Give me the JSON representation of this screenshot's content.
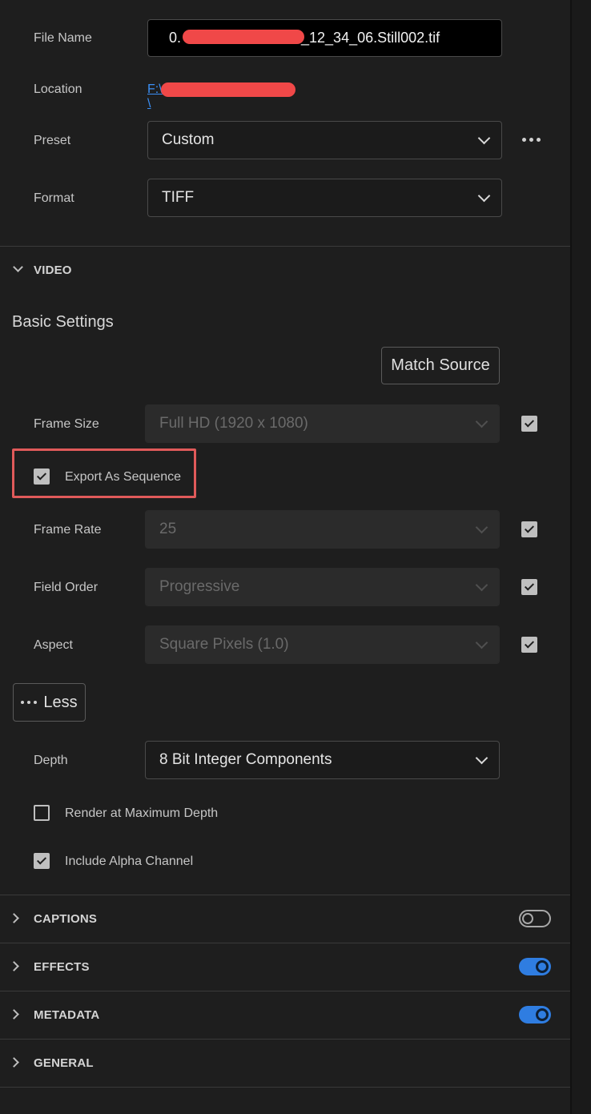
{
  "file": {
    "filename_label": "File Name",
    "filename_prefix": "0.",
    "filename_suffix": "_12_34_06.Still002.tif",
    "location_label": "Location",
    "location_prefix": "F:\\",
    "location_suffix": "\\",
    "preset_label": "Preset",
    "preset_value": "Custom",
    "format_label": "Format",
    "format_value": "TIFF"
  },
  "video": {
    "section_title": "VIDEO",
    "basic_settings": "Basic Settings",
    "match_source": "Match Source",
    "frame_size_label": "Frame Size",
    "frame_size_value": "Full HD (1920 x 1080)",
    "export_as_sequence": "Export As Sequence",
    "frame_rate_label": "Frame Rate",
    "frame_rate_value": "25",
    "field_order_label": "Field Order",
    "field_order_value": "Progressive",
    "aspect_label": "Aspect",
    "aspect_value": "Square Pixels (1.0)",
    "less_button": "Less",
    "depth_label": "Depth",
    "depth_value": "8 Bit Integer Components",
    "render_max_depth": "Render at Maximum Depth",
    "include_alpha": "Include Alpha Channel"
  },
  "sections": {
    "captions": "CAPTIONS",
    "effects": "EFFECTS",
    "metadata": "METADATA",
    "general": "GENERAL"
  },
  "colors": {
    "background": "#1e1e1e",
    "accent": "#2f7de1",
    "highlight": "#e05a5a",
    "link": "#3b8ff5"
  }
}
